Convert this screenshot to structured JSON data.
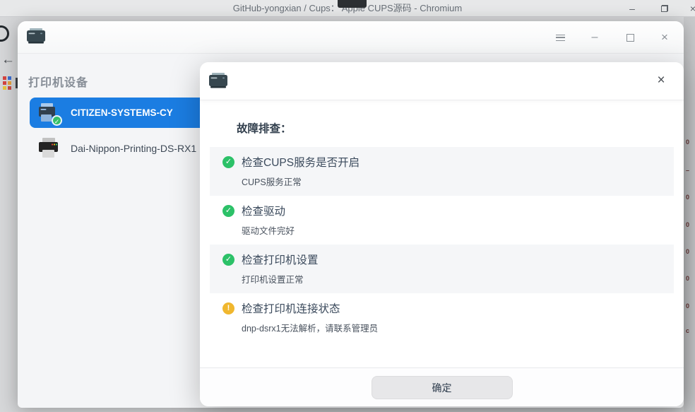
{
  "browser": {
    "title": "GitHub-yongxian / Cups： Apple CUPS源码 - Chromium",
    "controls": {
      "minimize": "–",
      "close": "×"
    },
    "left_rail": {
      "back_arrow": "←"
    },
    "right_rail_glyphs": [
      "0",
      "–",
      "0",
      "0",
      "0",
      "0",
      "0",
      "c"
    ]
  },
  "app": {
    "controls": {
      "minimize": "–",
      "close": "×"
    },
    "sidebar": {
      "title": "打印机设备",
      "printers": [
        {
          "name": "CITIZEN-SYSTEMS-CY",
          "selected": true,
          "badge": "✓"
        },
        {
          "name": "Dai-Nippon-Printing-DS-RX1",
          "selected": false
        }
      ]
    }
  },
  "dialog": {
    "close": "×",
    "heading": "故障排查：",
    "checks": [
      {
        "title": "检查CUPS服务是否开启",
        "detail": "CUPS服务正常",
        "status": "ok",
        "glyph": "✓"
      },
      {
        "title": "检查驱动",
        "detail": "驱动文件完好",
        "status": "ok",
        "glyph": "✓"
      },
      {
        "title": "检查打印机设置",
        "detail": "打印机设置正常",
        "status": "ok",
        "glyph": "✓"
      },
      {
        "title": "检查打印机连接状态",
        "detail": "dnp-dsrx1无法解析，请联系管理员",
        "status": "warning",
        "glyph": "!"
      }
    ],
    "confirm_label": "确定"
  },
  "colors": {
    "selected_row_blue": "#1b7de2",
    "success_green": "#2cc168",
    "warning_yellow": "#f0b72e",
    "dialog_alt_row": "#f5f6f8"
  }
}
